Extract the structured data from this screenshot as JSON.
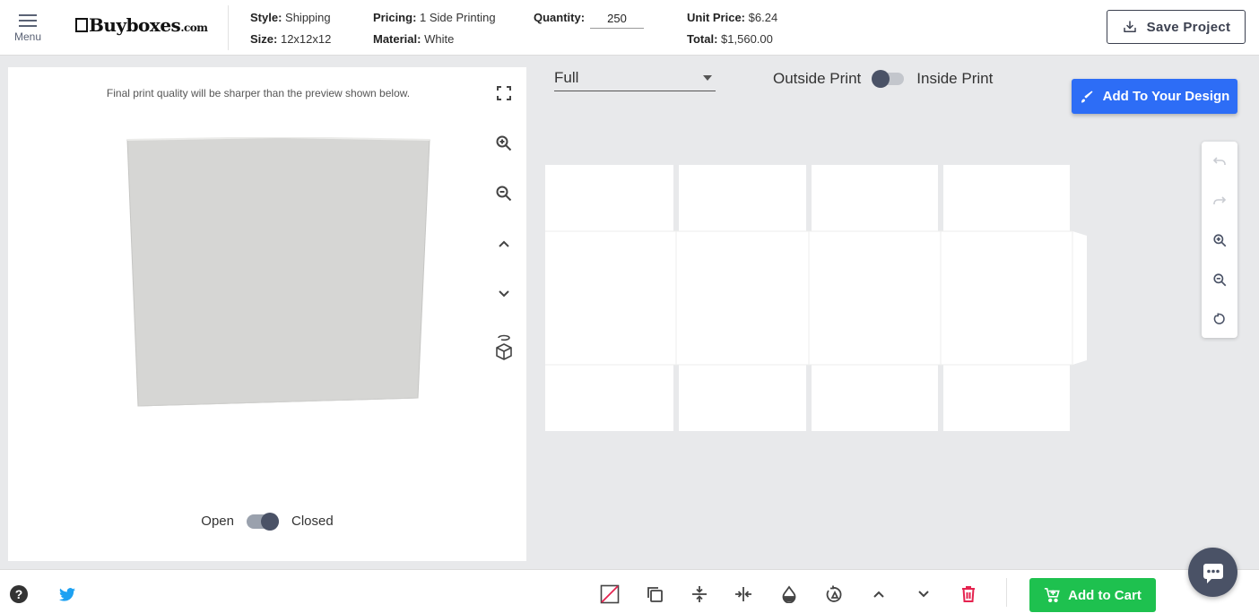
{
  "header": {
    "menu_label": "Menu",
    "logo_main": "Buyboxes",
    "logo_suffix": ".com",
    "style_label": "Style:",
    "style_value": "Shipping",
    "size_label": "Size:",
    "size_value": "12x12x12",
    "pricing_label": "Pricing:",
    "pricing_value": "1 Side Printing",
    "material_label": "Material:",
    "material_value": "White",
    "quantity_label": "Quantity:",
    "quantity_value": "250",
    "unit_price_label": "Unit Price:",
    "unit_price_value": "$6.24",
    "total_label": "Total:",
    "total_value": "$1,560.00",
    "save_label": "Save Project"
  },
  "preview": {
    "note": "Final print quality will be sharper than the preview shown below.",
    "open_label": "Open",
    "closed_label": "Closed",
    "state_closed": true,
    "tools": [
      "fullscreen-icon",
      "zoom-in-icon",
      "zoom-out-icon",
      "chevron-up-icon",
      "chevron-down-icon",
      "box-rotate-icon"
    ]
  },
  "editor": {
    "view_select_value": "Full",
    "outside_print_label": "Outside Print",
    "inside_print_label": "Inside Print",
    "inside_print_enabled": false,
    "add_design_label": "Add To Your Design",
    "canvas_tools": [
      "undo-icon",
      "redo-icon",
      "zoom-in-icon",
      "zoom-out-icon",
      "reset-icon"
    ]
  },
  "footer": {
    "left_icons": [
      "help-icon",
      "twitter-icon"
    ],
    "tools": [
      "no-fill-icon",
      "duplicate-icon",
      "align-vertical-center-icon",
      "align-horizontal-center-icon",
      "opacity-icon",
      "rotate-icon",
      "bring-forward-icon",
      "send-backward-icon",
      "delete-icon"
    ],
    "add_to_cart_label": "Add to Cart"
  },
  "colors": {
    "primary_blue": "#2d6df6",
    "cart_green": "#1ec14f",
    "delete_red": "#e5234f",
    "twitter_blue": "#1da1f2",
    "dark_slate": "#4a5266",
    "canvas_bg": "#e8e9eb"
  }
}
